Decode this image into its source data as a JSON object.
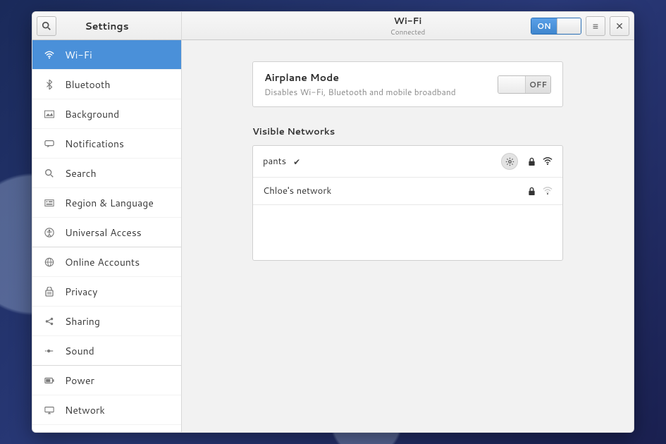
{
  "sidebar": {
    "title": "Settings",
    "items": [
      {
        "label": "Wi-Fi"
      },
      {
        "label": "Bluetooth"
      },
      {
        "label": "Background"
      },
      {
        "label": "Notifications"
      },
      {
        "label": "Search"
      },
      {
        "label": "Region & Language"
      },
      {
        "label": "Universal Access"
      },
      {
        "label": "Online Accounts"
      },
      {
        "label": "Privacy"
      },
      {
        "label": "Sharing"
      },
      {
        "label": "Sound"
      },
      {
        "label": "Power"
      },
      {
        "label": "Network"
      }
    ]
  },
  "header": {
    "title": "Wi-Fi",
    "subtitle": "Connected",
    "wifi_toggle_on": "ON"
  },
  "airplane": {
    "title": "Airplane Mode",
    "desc": "Disables Wi-Fi, Bluetooth and mobile broadband",
    "state": "OFF"
  },
  "networks": {
    "section_label": "Visible Networks",
    "list": [
      {
        "name": "pants",
        "connected": true,
        "secure": true,
        "signal": "strong"
      },
      {
        "name": "Chloe's network",
        "connected": false,
        "secure": true,
        "signal": "weak"
      }
    ]
  }
}
